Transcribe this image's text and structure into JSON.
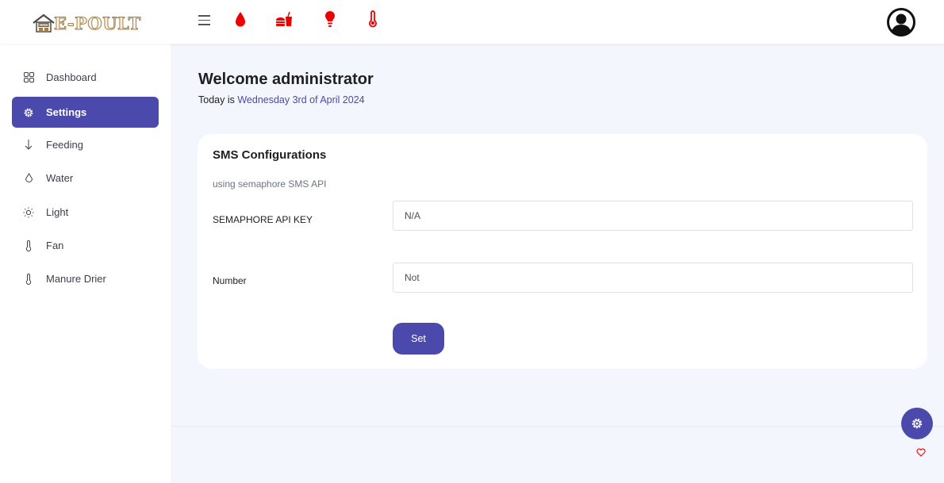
{
  "header": {
    "logo_text": "E-POULT",
    "icons": [
      "menu-icon",
      "water-drop-icon",
      "feeding-icon",
      "light-bulb-icon",
      "thermometer-icon",
      "user-avatar-icon"
    ],
    "icon_color": "#ee0000"
  },
  "sidebar": {
    "items": [
      {
        "label": "Dashboard",
        "icon": "grid-icon"
      },
      {
        "label": "Settings",
        "icon": "gear-icon"
      },
      {
        "label": "Feeding",
        "icon": "arrow-down-icon"
      },
      {
        "label": "Water",
        "icon": "droplet-icon"
      },
      {
        "label": "Light",
        "icon": "sun-icon"
      },
      {
        "label": "Fan",
        "icon": "thermometer-icon"
      },
      {
        "label": "Manure Drier",
        "icon": "thermometer-icon"
      }
    ],
    "active": "Settings"
  },
  "main": {
    "welcome": "Welcome administrator",
    "today_prefix": "Today is ",
    "today_date": "Wednesday 3rd of April 2024"
  },
  "card": {
    "title": "SMS Configurations",
    "subtitle": "using semaphore SMS API",
    "fields": [
      {
        "label": "SEMAPHORE API KEY",
        "value": "N/A"
      },
      {
        "label": "Number",
        "value": "Not"
      }
    ],
    "button_label": "Set"
  },
  "colors": {
    "accent": "#4b49ac",
    "background": "#f4f6fd",
    "alert_red": "#ee0000"
  }
}
